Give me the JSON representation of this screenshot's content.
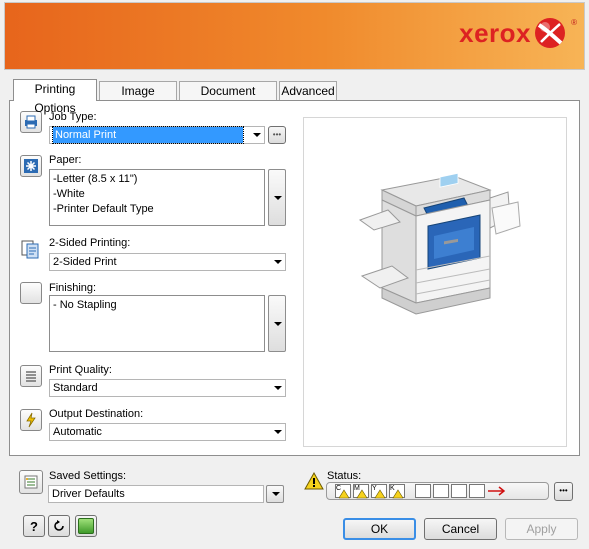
{
  "brand": {
    "name": "xerox",
    "reg": "®",
    "logo_color": "#dd2222",
    "banner_colors": [
      "#e7651c",
      "#f7b456"
    ]
  },
  "tabs": [
    {
      "label": "Printing Options",
      "active": true
    },
    {
      "label": "Image Options",
      "active": false
    },
    {
      "label": "Document Options",
      "active": false
    },
    {
      "label": "Advanced",
      "active": false
    }
  ],
  "job_type": {
    "label": "Job Type:",
    "value": "Normal Print",
    "more_button": "•••"
  },
  "paper": {
    "label": "Paper:",
    "lines": [
      "-Letter (8.5 x 11\")",
      "-White",
      "-Printer Default Type"
    ]
  },
  "two_sided": {
    "label": "2-Sided Printing:",
    "value": "2-Sided Print"
  },
  "finishing": {
    "label": "Finishing:",
    "lines": [
      "- No Stapling"
    ]
  },
  "quality": {
    "label": "Print Quality:",
    "value": "Standard"
  },
  "output": {
    "label": "Output Destination:",
    "value": "Automatic"
  },
  "saved": {
    "label": "Saved Settings:",
    "value": "Driver Defaults"
  },
  "status": {
    "label": "Status:",
    "more_button": "•••",
    "toner_letters": [
      "C",
      "M",
      "Y",
      "K"
    ]
  },
  "buttons": {
    "help": "?",
    "ok": "OK",
    "cancel": "Cancel",
    "apply": "Apply"
  }
}
